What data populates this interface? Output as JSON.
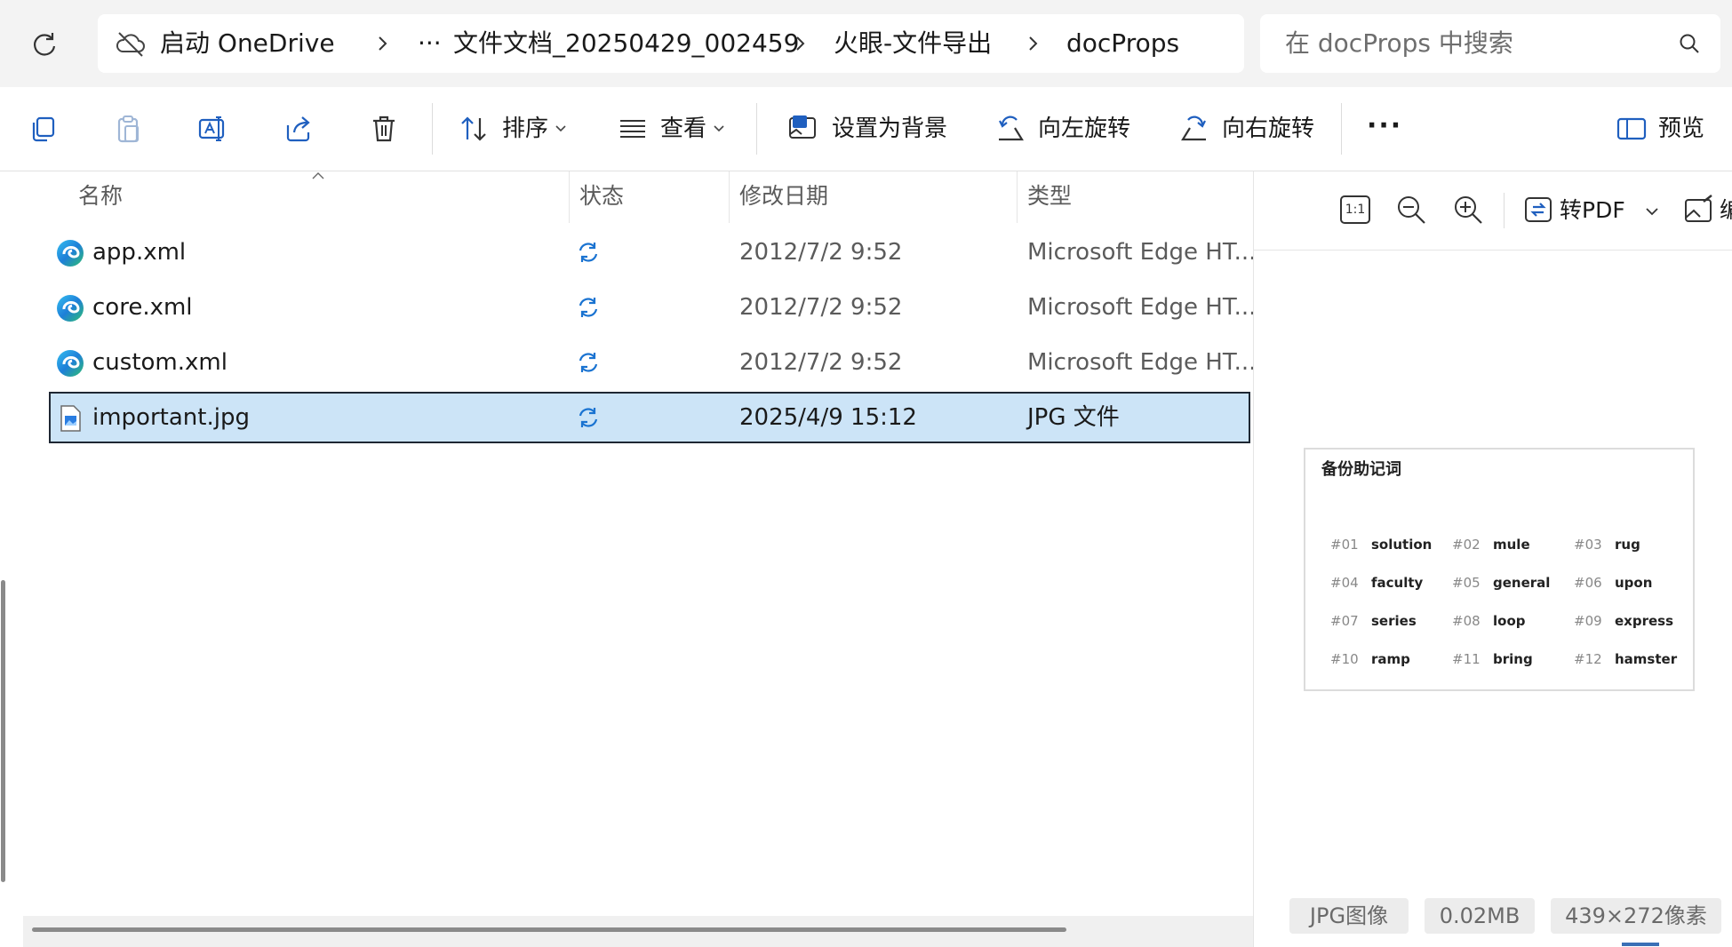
{
  "breadcrumb": {
    "items": [
      "启动 OneDrive",
      "···",
      "文件文档_20250429_002459",
      "火眼-文件导出",
      "docProps"
    ]
  },
  "search": {
    "placeholder": "在 docProps 中搜索"
  },
  "toolbar": {
    "sort_label": "排序",
    "view_label": "查看",
    "set_background_label": "设置为背景",
    "rotate_left_label": "向左旋转",
    "rotate_right_label": "向右旋转",
    "more_label": "···",
    "preview_label": "预览"
  },
  "columns": {
    "name": "名称",
    "status": "状态",
    "modified": "修改日期",
    "type": "类型"
  },
  "files": [
    {
      "name": "app.xml",
      "date": "2012/7/2 9:52",
      "type": "Microsoft Edge HT...",
      "icon": "edge-icon"
    },
    {
      "name": "core.xml",
      "date": "2012/7/2 9:52",
      "type": "Microsoft Edge HT...",
      "icon": "edge-icon"
    },
    {
      "name": "custom.xml",
      "date": "2012/7/2 9:52",
      "type": "Microsoft Edge HT...",
      "icon": "edge-icon"
    },
    {
      "name": "important.jpg",
      "date": "2025/4/9 15:12",
      "type": "JPG 文件",
      "icon": "image-file-icon",
      "selected": true
    }
  ],
  "preview": {
    "actual_size_label": "1:1",
    "to_pdf_label": "转PDF",
    "edit_label": "编",
    "image": {
      "title": "备份助记词",
      "words": [
        {
          "num": "#01",
          "word": "solution"
        },
        {
          "num": "#02",
          "word": "mule"
        },
        {
          "num": "#03",
          "word": "rug"
        },
        {
          "num": "#04",
          "word": "faculty"
        },
        {
          "num": "#05",
          "word": "general"
        },
        {
          "num": "#06",
          "word": "upon"
        },
        {
          "num": "#07",
          "word": "series"
        },
        {
          "num": "#08",
          "word": "loop"
        },
        {
          "num": "#09",
          "word": "express"
        },
        {
          "num": "#10",
          "word": "ramp"
        },
        {
          "num": "#11",
          "word": "bring"
        },
        {
          "num": "#12",
          "word": "hamster"
        }
      ]
    },
    "info": {
      "format": "JPG图像",
      "size": "0.02MB",
      "dimensions": "439×272像素"
    }
  },
  "colors": {
    "selection": "#cce4f7",
    "accent": "#0067c0",
    "sync": "#1a73d1"
  }
}
